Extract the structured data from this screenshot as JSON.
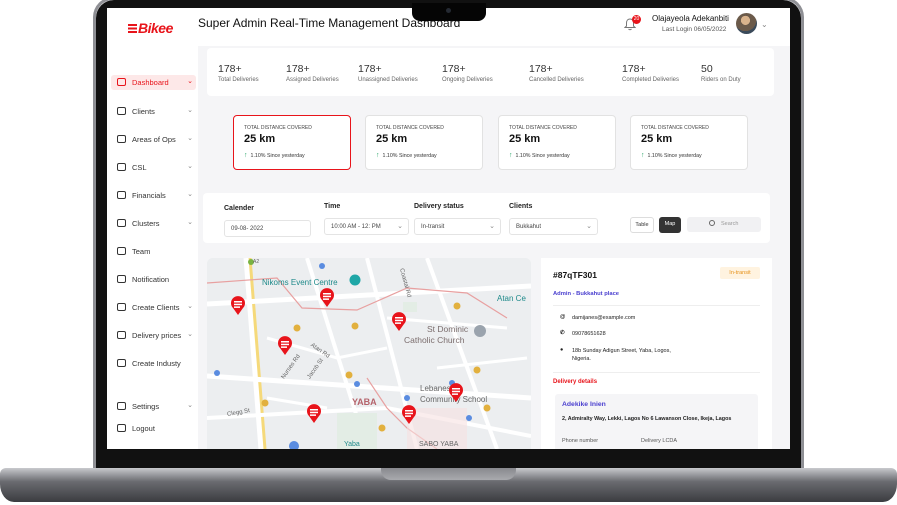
{
  "header": {
    "logo": "Bikee",
    "title": "Super Admin Real-Time Management Dashboard",
    "notifications_count": "20",
    "user_name": "Olajayeola Adekanbiti",
    "last_login": "Last Login 06/05/2022"
  },
  "sidebar": {
    "items": [
      {
        "label": "Dashboard",
        "icon": "dashboard-icon",
        "active": true,
        "chevron": true
      },
      {
        "label": "Clients",
        "icon": "chart-icon",
        "chevron": true
      },
      {
        "label": "Areas of Ops",
        "icon": "briefcase-icon",
        "chevron": true
      },
      {
        "label": "CSL",
        "icon": "briefcase-icon",
        "chevron": true
      },
      {
        "label": "Financials",
        "icon": "briefcase-icon",
        "chevron": true
      },
      {
        "label": "Clusters",
        "icon": "briefcase-icon",
        "chevron": true
      },
      {
        "label": "Team",
        "icon": "briefcase-icon",
        "chevron": false
      },
      {
        "label": "Notification",
        "icon": "chart-icon",
        "chevron": false
      },
      {
        "label": "Create Clients",
        "icon": "chart-icon",
        "chevron": true
      },
      {
        "label": "Delivery prices",
        "icon": "briefcase-icon",
        "chevron": true
      },
      {
        "label": "Create Industy",
        "icon": "chart-icon",
        "chevron": false
      }
    ],
    "settings": "Settings",
    "logout": "Logout"
  },
  "stats": [
    {
      "value": "178+",
      "caption": "Total Deliveries"
    },
    {
      "value": "178+",
      "caption": "Assigned Deliveries"
    },
    {
      "value": "178+",
      "caption": "Unassigned Deliveries"
    },
    {
      "value": "178+",
      "caption": "Ongoing Deliveries"
    },
    {
      "value": "178+",
      "caption": "Cancelled Deliveries"
    },
    {
      "value": "178+",
      "caption": "Completed  Deliveries"
    },
    {
      "value": "50",
      "caption": "Riders on Duty"
    }
  ],
  "distance_cards": [
    {
      "title": "TOTAL DISTANCE COVERED",
      "value": "25 km",
      "change": "1.10% Since yesterday",
      "active": true
    },
    {
      "title": "TOTAL DISTANCE COVERED",
      "value": "25 km",
      "change": "1.10% Since yesterday",
      "active": false
    },
    {
      "title": "TOTAL DISTANCE COVERED",
      "value": "25 km",
      "change": "1.10% Since yesterday",
      "active": false
    },
    {
      "title": "TOTAL DISTANCE COVERED",
      "value": "25 km",
      "change": "1.10% Since yesterday",
      "active": false
    }
  ],
  "filters": {
    "calendar_label": "Calender",
    "calendar_value": "09-08- 2022",
    "time_label": "Time",
    "time_value": "10:00 AM - 12: PM",
    "status_label": "Delivery status",
    "status_value": "In-transit",
    "clients_label": "Clients",
    "clients_value": "Bukkahut",
    "table_btn": "Table",
    "map_btn": "Map",
    "search_placeholder": "Search"
  },
  "map": {
    "labels": [
      "Nikoms Event Centre",
      "Atan Ce",
      "St Dominic",
      "Catholic Church",
      "Lebanese",
      "Community School",
      "YABA",
      "Atan Rd",
      "Nurses Rd",
      "Jacob St",
      "Clegg St",
      "SABO YABA",
      "Yaba",
      "Coastal Rd",
      "A2"
    ]
  },
  "order": {
    "id": "#87qTF301",
    "status": "In-transit",
    "owner": "Admin - Bukkahut place",
    "email": "damijanes@example.com",
    "phone": "09078651628",
    "address": "18b Sunday Adigun Street, Yaba, Logos, Nigeria.",
    "section_title": "Delivery details",
    "recipient_name": "Adekike Inien",
    "recipient_address": "2, Admiralty Way, Lekki, Lagos No 6 Lawanson Close, Ikeja, Lagos",
    "phone_label": "Phone number",
    "lcda_label": "Delivery LCDA"
  }
}
